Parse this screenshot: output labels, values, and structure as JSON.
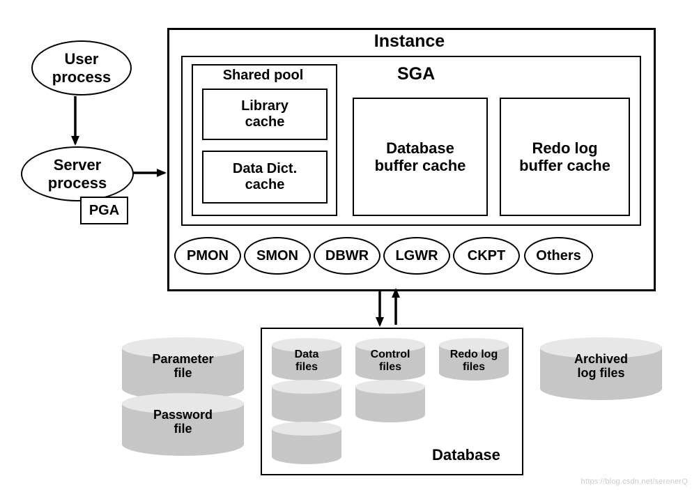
{
  "user_process": "User\nprocess",
  "server_process": "Server\nprocess",
  "pga": "PGA",
  "instance": {
    "title": "Instance",
    "sga": {
      "title": "SGA",
      "shared_pool": {
        "title": "Shared pool",
        "library_cache": "Library\ncache",
        "data_dict_cache": "Data Dict.\ncache"
      },
      "db_buffer_cache": "Database\nbuffer cache",
      "redo_log_buffer_cache": "Redo log\nbuffer cache"
    },
    "processes": {
      "pmon": "PMON",
      "smon": "SMON",
      "dbwr": "DBWR",
      "lgwr": "LGWR",
      "ckpt": "CKPT",
      "others": "Others"
    }
  },
  "parameter_file": "Parameter\nfile",
  "password_file": "Password\nfile",
  "database": {
    "title": "Database",
    "data_files": "Data\nfiles",
    "control_files": "Control\nfiles",
    "redo_log_files": "Redo log\nfiles"
  },
  "archived_log_files": "Archived\nlog files",
  "watermark": "https://blog.csdn.net/serenerQ"
}
